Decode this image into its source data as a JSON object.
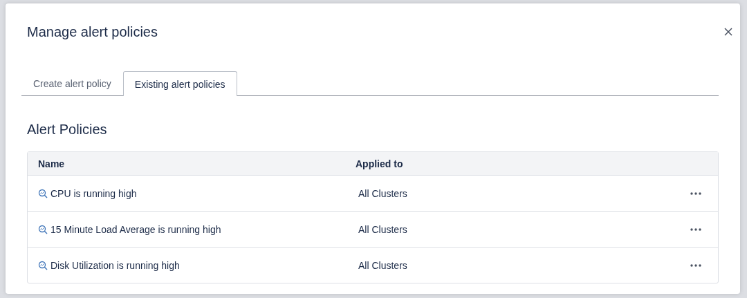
{
  "dialog": {
    "title": "Manage alert policies"
  },
  "tabs": [
    {
      "label": "Create alert policy",
      "selected": false
    },
    {
      "label": "Existing alert policies",
      "selected": true
    }
  ],
  "section": {
    "heading": "Alert Policies"
  },
  "table": {
    "columns": [
      "Name",
      "Applied to"
    ],
    "rows": [
      {
        "name": "CPU is running high",
        "applied_to": "All Clusters"
      },
      {
        "name": "15 Minute Load Average is running high",
        "applied_to": "All Clusters"
      },
      {
        "name": "Disk Utilization is running high",
        "applied_to": "All Clusters"
      }
    ]
  }
}
